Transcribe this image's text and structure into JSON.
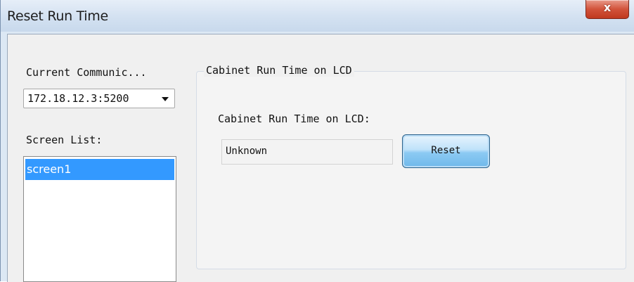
{
  "window": {
    "title": "Reset Run Time",
    "close_label": "x"
  },
  "left_panel": {
    "communication_label": "Current Communic...",
    "communication_value": "172.18.12.3:5200",
    "screen_list_label": "Screen List:",
    "screens": [
      "screen1"
    ],
    "selected_screen": "screen1"
  },
  "cabinet_group": {
    "title": "Cabinet Run Time on LCD",
    "field_label": "Cabinet Run Time on LCD:",
    "field_value": "Unknown",
    "reset_label": "Reset"
  },
  "colors": {
    "selection": "#3399ff",
    "close_button": "#c0391f",
    "title_bar": "#d3e1f1"
  }
}
